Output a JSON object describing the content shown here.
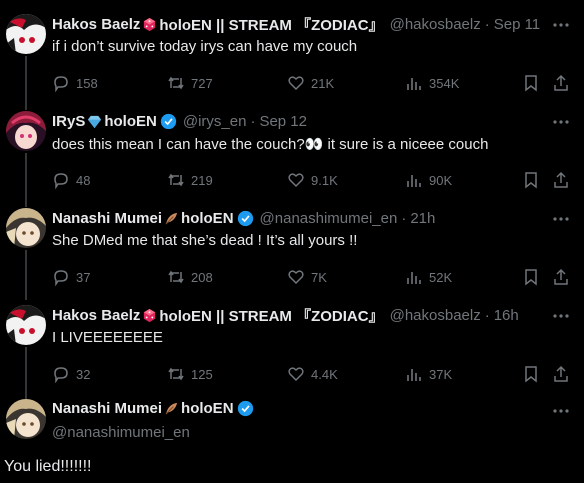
{
  "colors": {
    "bg": "#000000",
    "text": "#e7e9ea",
    "muted": "#71767b",
    "verified": "#1d9bf0",
    "divider": "#333639"
  },
  "tweets": [
    {
      "name": "Hakos Baelz",
      "name_suffix": "holoEN || STREAM 『ZODIAC』",
      "emoji": "dice-icon",
      "handle": "@hakosbaelz",
      "time": "Sep 11",
      "text": "if i don’t survive today irys can have my couch",
      "replies": "158",
      "reposts": "727",
      "likes": "21K",
      "views": "354K",
      "verified": false
    },
    {
      "name": "IRyS",
      "name_suffix": "holoEN",
      "emoji": "gem-icon",
      "handle": "@irys_en",
      "time": "Sep 12",
      "text": "does this mean I can have the couch?👀 it sure is a niceee couch",
      "replies": "48",
      "reposts": "219",
      "likes": "9.1K",
      "views": "90K",
      "verified": true
    },
    {
      "name": "Nanashi Mumei",
      "name_suffix": "holoEN",
      "emoji": "feather-icon",
      "handle": "@nanashimumei_en",
      "time": "21h",
      "text": "She DMed me that she’s dead ! It’s all yours !!",
      "replies": "37",
      "reposts": "208",
      "likes": "7K",
      "views": "52K",
      "verified": true
    },
    {
      "name": "Hakos Baelz",
      "name_suffix": "holoEN || STREAM 『ZODIAC』",
      "emoji": "dice-icon",
      "handle": "@hakosbaelz",
      "time": "16h",
      "text": "I LIVEEEEEEEE",
      "replies": "32",
      "reposts": "125",
      "likes": "4.4K",
      "views": "37K",
      "verified": false
    }
  ],
  "final": {
    "name": "Nanashi Mumei",
    "name_suffix": "holoEN",
    "emoji": "feather-icon",
    "handle": "@nanashimumei_en",
    "text": "You lied!!!!!!!",
    "verified": true
  },
  "separator": "·"
}
